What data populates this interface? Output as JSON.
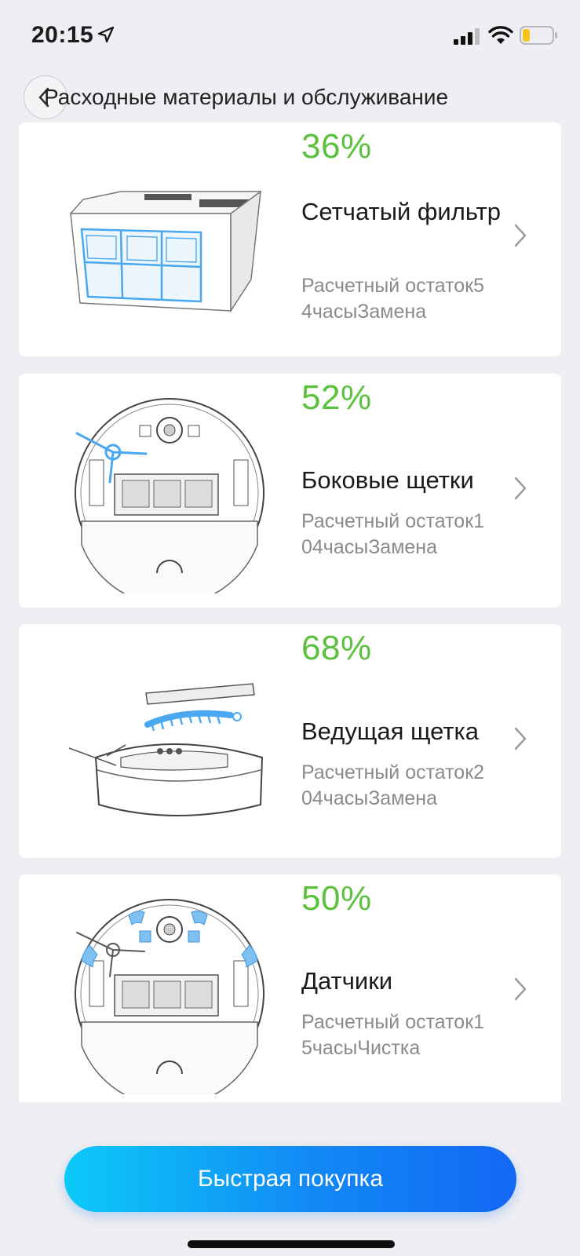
{
  "status_bar": {
    "time": "20:15",
    "icons": [
      "location-arrow-icon",
      "cellular-signal-icon",
      "wifi-icon",
      "battery-low-icon"
    ],
    "battery_color": "#f5c518"
  },
  "header": {
    "title": "Расходные материалы и обслуживание",
    "back_icon": "chevron-left-icon"
  },
  "items": [
    {
      "percent": "36%",
      "name": "Сетчатый фильтр",
      "desc": "Расчетный остаток54часыЗамена",
      "illustration": "filter-illustration"
    },
    {
      "percent": "52%",
      "name": "Боковые щетки",
      "desc": "Расчетный остаток104часыЗамена",
      "illustration": "side-brush-illustration"
    },
    {
      "percent": "68%",
      "name": "Ведущая щетка",
      "desc": "Расчетный остаток204часыЗамена",
      "illustration": "main-brush-illustration"
    },
    {
      "percent": "50%",
      "name": "Датчики",
      "desc": "Расчетный остаток15часыЧистка",
      "illustration": "sensors-illustration"
    }
  ],
  "footer": {
    "buy_label": "Быстрая покупка"
  },
  "colors": {
    "percent_green": "#5cc13e",
    "accent_blue": "#1289f5",
    "highlight_blue": "#4aa8f0"
  }
}
